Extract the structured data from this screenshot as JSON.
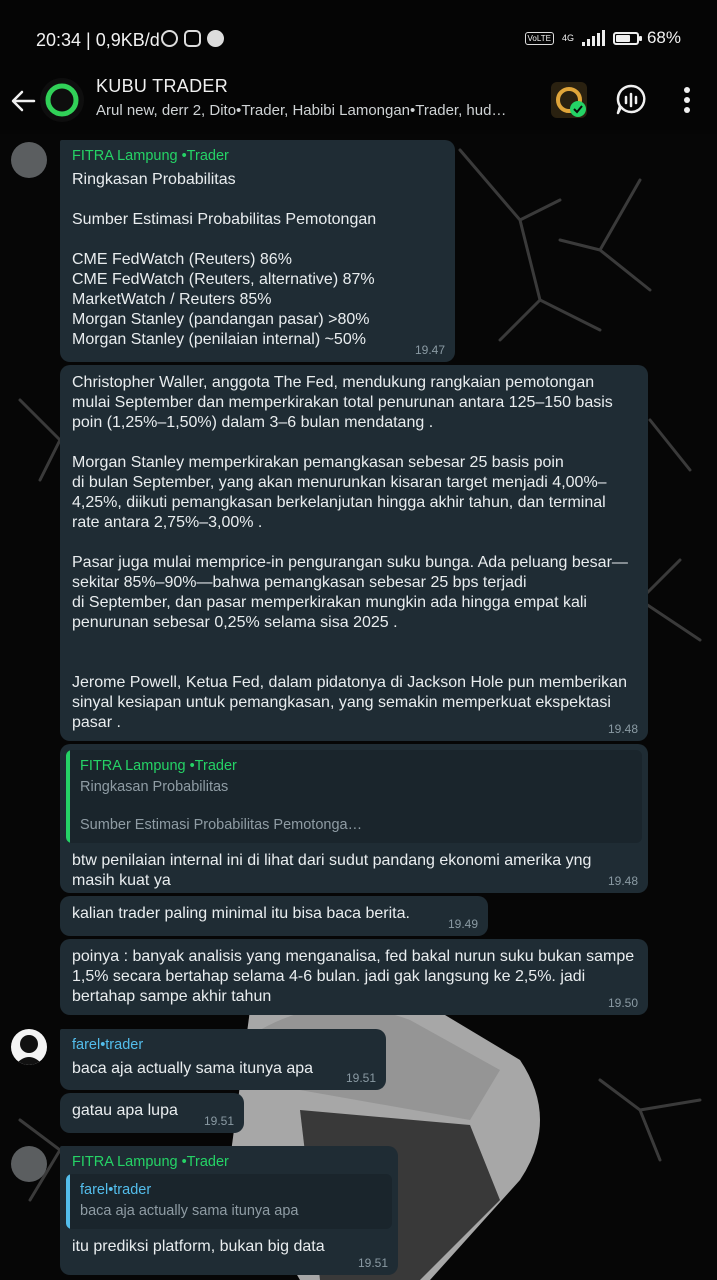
{
  "status_bar": {
    "time_speed": "20:34 | 0,9KB/d",
    "volte": "VoLTE",
    "network": "4G",
    "battery": "68%",
    "battery_level": 0.68
  },
  "header": {
    "title": "KUBU TRADER",
    "members": "Arul new, derr 2, Dito•Trader, Habibi Lamongan•Trader, hud…"
  },
  "messages": [
    {
      "sender": "FITRA Lampung •Trader",
      "text": "Ringkasan Probabilitas\n\nSumber   Estimasi Probabilitas Pemotongan\n\nCME FedWatch (Reuters) 86%\nCME FedWatch (Reuters, alternative)   87%\nMarketWatch / Reuters 85%\nMorgan Stanley (pandangan pasar) >80%\nMorgan Stanley (penilaian internal)  ~50%",
      "time": "19.47"
    },
    {
      "text": "Christopher Waller, anggota The Fed, mendukung rangkaian pemotongan mulai September dan memperkirakan total penurunan antara 125–150 basis poin (1,25%–1,50%) dalam 3–6 bulan mendatang .\n\nMorgan Stanley memperkirakan pemangkasan sebesar 25 basis poin\ndi bulan September, yang akan menurunkan kisaran target menjadi 4,00%–4,25%, diikuti pemangkasan berkelanjutan hingga akhir tahun, dan terminal rate antara 2,75%–3,00% .\n\nPasar juga mulai memprice-in pengurangan suku bunga. Ada peluang besar—sekitar 85%–90%—bahwa pemangkasan sebesar 25 bps terjadi\ndi September, dan pasar memperkirakan mungkin ada hingga empat kali penurunan sebesar 0,25% selama sisa 2025 .\n\n\nJerome Powell, Ketua Fed, dalam pidatonya di Jackson Hole pun memberikan sinyal kesiapan untuk pemangkasan, yang semakin memperkuat ekspektasi pasar .",
      "time": "19.48"
    },
    {
      "quote_sender": "FITRA Lampung •Trader",
      "quote_text": "Ringkasan Probabilitas\n\nSumber   Estimasi Probabilitas Pemotonga…",
      "text": "btw penilaian internal ini di lihat dari sudut pandang ekonomi amerika yng masih kuat ya",
      "time": "19.48"
    },
    {
      "text": "kalian trader paling minimal itu bisa baca berita.",
      "time": "19.49"
    },
    {
      "text": "poinya : banyak analisis yang menganalisa, fed bakal nurun suku bukan sampe 1,5% secara bertahap selama 4-6 bulan. jadi gak langsung ke 2,5%. jadi bertahap sampe akhir tahun",
      "time": "19.50"
    },
    {
      "sender": "farel•trader",
      "text": "baca aja actually sama itunya apa",
      "time": "19.51"
    },
    {
      "text": "gatau apa lupa",
      "time": "19.51"
    },
    {
      "sender": "FITRA Lampung •Trader",
      "quote_sender": "farel•trader",
      "quote_text": "baca aja actually sama itunya apa",
      "text": "itu prediksi platform, bukan big data",
      "time": "19.51"
    }
  ]
}
